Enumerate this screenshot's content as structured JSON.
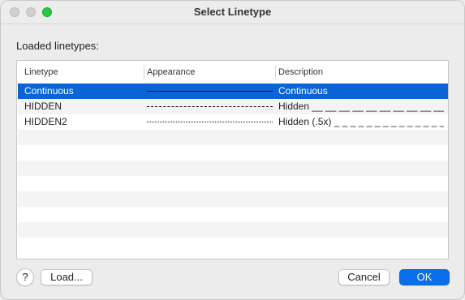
{
  "window": {
    "title": "Select Linetype"
  },
  "section_label": "Loaded linetypes:",
  "table": {
    "columns": [
      "Linetype",
      "Appearance",
      "Description"
    ],
    "rows": [
      {
        "name": "Continuous",
        "appearance": "solid",
        "description": "Continuous",
        "selected": true
      },
      {
        "name": "HIDDEN",
        "appearance": "dashed",
        "description": "Hidden __ __ __ __ __ __ __ __ __ __ __ __ __",
        "selected": false
      },
      {
        "name": "HIDDEN2",
        "appearance": "dotted",
        "description": "Hidden (.5x) _ _ _ _ _ _ _ _ _ _ _ _ _ _ _ _ _ _",
        "selected": false
      }
    ]
  },
  "buttons": {
    "help": "?",
    "load": "Load...",
    "cancel": "Cancel",
    "ok": "OK"
  },
  "colors": {
    "selection": "#0a64d8",
    "primary_button": "#0a6fe8",
    "maximize": "#2ac840"
  }
}
